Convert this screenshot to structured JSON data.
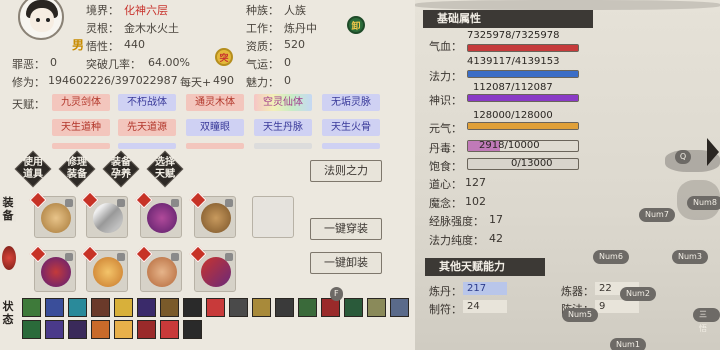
{
  "header": {
    "jingjie_label": "境界：",
    "jingjie_value": "化神六层",
    "linggen_label": "灵根：",
    "linggen_value": "金木水火土",
    "wuxing_label": "悟性：",
    "wuxing_value": "440",
    "gender": "男",
    "zhongzu_label": "种族：",
    "zhongzu_value": "人族",
    "gongzuo_label": "工作：",
    "gongzuo_value": "炼丹中",
    "zizhi_label": "资质：",
    "zizhi_value": "520",
    "qiyun_label": "气运：",
    "qiyun_value": "0",
    "meili_label": "魅力：",
    "meili_value": "0",
    "zuinian_label": "罪恶：",
    "zuinian_value": "0",
    "tupo_label": "突破几率：",
    "tupo_value": "64.00%",
    "xiuwei_label": "修为：",
    "xiuwei_value": "194602226/397022987",
    "meitian_label": "每天+",
    "meitian_value": "490",
    "badge_tu": "突",
    "badge_xie": "卸"
  },
  "talents": {
    "label": "天赋：",
    "rows": [
      [
        {
          "t": "九灵剑体",
          "c": "red"
        },
        {
          "t": "不朽战体",
          "c": "blue"
        },
        {
          "t": "通灵木体",
          "c": "red"
        },
        {
          "t": "空灵仙体",
          "c": "rainbow"
        },
        {
          "t": "无垢灵脉",
          "c": "blue"
        }
      ],
      [
        {
          "t": "天生道种",
          "c": "red"
        },
        {
          "t": "先天道源",
          "c": "red"
        },
        {
          "t": "双瞳眼",
          "c": "blue"
        },
        {
          "t": "天生丹脉",
          "c": "blue"
        },
        {
          "t": "天生火骨",
          "c": "blue"
        }
      ]
    ]
  },
  "actions": {
    "use_item": "使用\n道具",
    "cultivate": "修理\n装备",
    "equip_pet": "装备\n孕养",
    "choose_talent": "选择\n天赋",
    "law_power": "法则之力",
    "equip_all": "一键穿装",
    "unequip_all": "一键卸装"
  },
  "side_labels": {
    "equip": "装\n备",
    "status": "状\n态"
  },
  "stats": {
    "section_title": "基础属性",
    "qixue_label": "气血：",
    "qixue_value": "7325978/7325978",
    "qixue_fill": 1.0,
    "fali_label": "法力：",
    "fali_value": "4139117/4139153",
    "fali_fill": 1.0,
    "shenshi_label": "神识：",
    "shenshi_value": "112087/112087",
    "shenshi_fill": 1.0,
    "yuanqi_label": "元气：",
    "yuanqi_value": "128000/128000",
    "yuanqi_fill": 1.0,
    "dandu_label": "丹毒：",
    "dandu_value": "2918/10000",
    "dandu_fill": 0.29,
    "baoshi_label": "饱食：",
    "baoshi_value": "0/13000",
    "baoshi_fill": 0.0,
    "daoxin_label": "道心：",
    "daoxin_value": "127",
    "monian_label": "魔念：",
    "monian_value": "102",
    "jingmai_label": "经脉强度：",
    "jingmai_value": "17",
    "falichundu_label": "法力纯度：",
    "falichundu_value": "42",
    "colors": {
      "qixue": "#c63b3b",
      "fali": "#3b6dc6",
      "shenshi": "#8a3bc6",
      "yuanqi": "#e0a038",
      "dandu": "#c07ab8",
      "baoshi": "#c8c4bc"
    }
  },
  "other": {
    "section_title": "其他天赋能力",
    "liandan_label": "炼丹：",
    "liandan_value": "217",
    "lianqi_label": "炼器：",
    "lianqi_value": "22",
    "zhifu_label": "制符：",
    "zhifu_value": "24",
    "zhenfa_label": "阵法：",
    "zhenfa_value": "9"
  },
  "chips": [
    "Q",
    "Num8",
    "Num7",
    "Num6",
    "Num3",
    "Num2",
    "Num5",
    "Num1",
    "F",
    "三悟"
  ]
}
